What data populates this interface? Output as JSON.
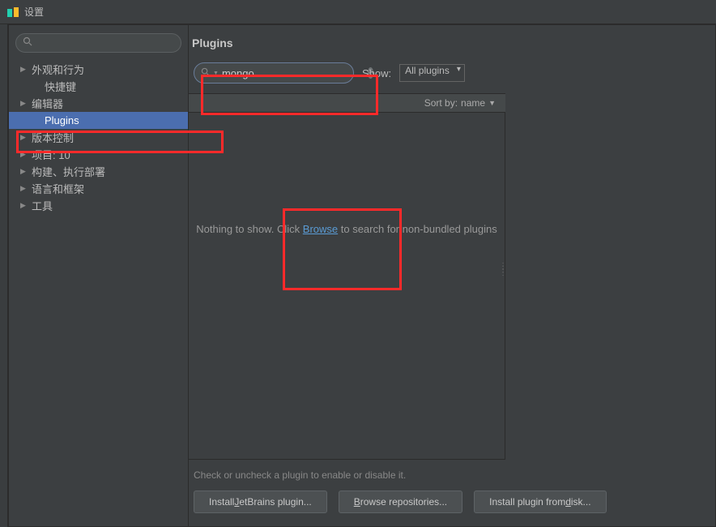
{
  "titlebar": {
    "title": "设置"
  },
  "sidebar": {
    "items": [
      {
        "label": "外观和行为",
        "expandable": true
      },
      {
        "label": "快捷键",
        "expandable": false,
        "indent": true
      },
      {
        "label": "编辑器",
        "expandable": true
      },
      {
        "label": "Plugins",
        "expandable": false,
        "indent": true,
        "selected": true
      },
      {
        "label": "版本控制",
        "expandable": true
      },
      {
        "label": "项目: 10",
        "expandable": true
      },
      {
        "label": "构建、执行部署",
        "expandable": true
      },
      {
        "label": "语言和框架",
        "expandable": true
      },
      {
        "label": "工具",
        "expandable": true
      }
    ]
  },
  "plugins": {
    "title": "Plugins",
    "search_value": "mongo",
    "show_label": "Show:",
    "show_value": "All plugins",
    "sort_label": "Sort by:",
    "sort_value": "name",
    "empty_prefix": "Nothing to show. Click ",
    "empty_link": "Browse",
    "empty_suffix": " to search for non-bundled plugins",
    "hint": "Check or uncheck a plugin to enable or disable it.",
    "buttons": {
      "jetbrains_pre": "Install ",
      "jetbrains_u": "J",
      "jetbrains_post": "etBrains plugin...",
      "browse_pre": "",
      "browse_u": "B",
      "browse_post": "rowse repositories...",
      "disk_pre": "Install plugin from ",
      "disk_u": "d",
      "disk_post": "isk..."
    }
  }
}
